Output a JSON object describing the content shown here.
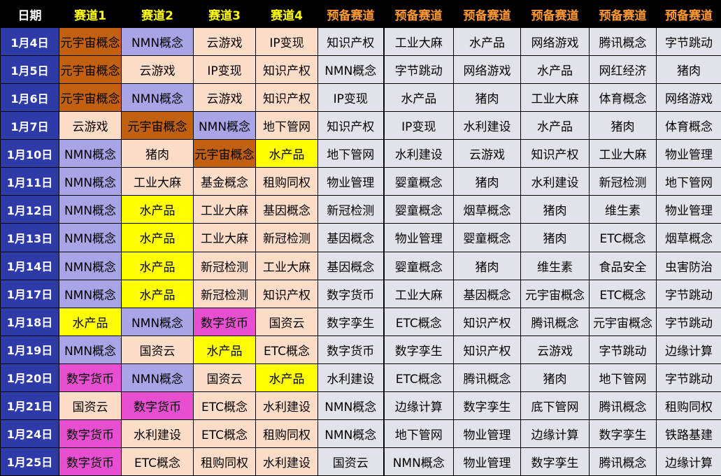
{
  "headers": [
    "日期",
    "赛道1",
    "赛道2",
    "赛道3",
    "赛道4",
    "预备赛道",
    "预备赛道",
    "预备赛道",
    "预备赛道",
    "预备赛道",
    "预备赛道"
  ],
  "colors": {
    "元宇宙概念": "#c06010",
    "NMN概念": "#a9a4e6",
    "水产品": "#ffff00",
    "数字货币": "#e84fd0",
    "default_main": "#fddcc8",
    "default_backup": "#e2e2ea",
    "date_bg": "#2e3aa8"
  },
  "rows": [
    {
      "date": "1月4日",
      "cells": [
        "元宇宙概念",
        "NMN概念",
        "云游戏",
        "IP变现",
        "知识产权",
        "工业大麻",
        "水产品",
        "网络游戏",
        "腾讯概念",
        "字节跳动"
      ]
    },
    {
      "date": "1月5日",
      "cells": [
        "元宇宙概念",
        "云游戏",
        "IP变现",
        "知识产权",
        "NMN概念",
        "字节跳动",
        "网络游戏",
        "水产品",
        "网红经济",
        "猪肉"
      ]
    },
    {
      "date": "1月6日",
      "cells": [
        "元宇宙概念",
        "NMN概念",
        "云游戏",
        "知识产权",
        "IP变现",
        "水产品",
        "猪肉",
        "工业大麻",
        "体育概念",
        "网络游戏"
      ]
    },
    {
      "date": "1月7日",
      "cells": [
        "云游戏",
        "元宇宙概念",
        "NMN概念",
        "地下管网",
        "知识产权",
        "IP变现",
        "水利建设",
        "水产品",
        "猪肉",
        "体育概念"
      ]
    },
    {
      "date": "1月10日",
      "cells": [
        "NMN概念",
        "猪肉",
        "元宇宙概念",
        "水产品",
        "地下管网",
        "水利建设",
        "云游戏",
        "知识产权",
        "工业大麻",
        "物业管理"
      ]
    },
    {
      "date": "1月11日",
      "cells": [
        "NMN概念",
        "工业大麻",
        "基金概念",
        "租购同权",
        "物业管理",
        "婴童概念",
        "猪肉",
        "水利建设",
        "新冠检测",
        "地下管网"
      ]
    },
    {
      "date": "1月12日",
      "cells": [
        "NMN概念",
        "水产品",
        "工业大麻",
        "基因概念",
        "新冠检测",
        "婴童概念",
        "烟草概念",
        "猪肉",
        "维生素",
        "物业管理"
      ]
    },
    {
      "date": "1月13日",
      "cells": [
        "NMN概念",
        "水产品",
        "工业大麻",
        "新冠检测",
        "基因概念",
        "物业管理",
        "婴童概念",
        "猪肉",
        "ETC概念",
        "烟草概念"
      ]
    },
    {
      "date": "1月14日",
      "cells": [
        "NMN概念",
        "水产品",
        "新冠检测",
        "工业大麻",
        "基因概念",
        "婴童概念",
        "猪肉",
        "维生素",
        "食品安全",
        "虫害防治"
      ]
    },
    {
      "date": "1月17日",
      "cells": [
        "NMN概念",
        "水产品",
        "新冠检测",
        "知识产权",
        "数字货币",
        "工业大麻",
        "基因概念",
        "元宇宙概念",
        "ETC概念",
        "字节跳动"
      ]
    },
    {
      "date": "1月18日",
      "cells": [
        "水产品",
        "NMN概念",
        "数字货币",
        "国资云",
        "数字孪生",
        "ETC概念",
        "知识产权",
        "腾讯概念",
        "元宇宙概念",
        "字节跳动"
      ]
    },
    {
      "date": "1月19日",
      "cells": [
        "NMN概念",
        "国资云",
        "水产品",
        "ETC概念",
        "数字货币",
        "数字孪生",
        "知识产权",
        "云游戏",
        "字节跳动",
        "边缘计算"
      ]
    },
    {
      "date": "1月20日",
      "cells": [
        "数字货币",
        "NMN概念",
        "国资云",
        "水产品",
        "水利建设",
        "ETC概念",
        "腾讯概念",
        "猪肉",
        "地下管网",
        "字节跳动"
      ]
    },
    {
      "date": "1月21日",
      "cells": [
        "国资云",
        "数字货币",
        "ETC概念",
        "水利建设",
        "NMN概念",
        "边缘计算",
        "数字孪生",
        "底下管网",
        "腾讯概念",
        "租购同权"
      ]
    },
    {
      "date": "1月24日",
      "cells": [
        "数字货币",
        "水利建设",
        "ETC概念",
        "租购同权",
        "NMN概念",
        "地下管网",
        "物业管理",
        "边缘计算",
        "数字孪生",
        "铁路基建"
      ]
    },
    {
      "date": "1月25日",
      "cells": [
        "数字货币",
        "ETC概念",
        "租购同权",
        "水利建设",
        "国资云",
        "NMN概念",
        "物业管理",
        "数字孪生",
        "腾讯概念",
        "边缘计算"
      ]
    }
  ]
}
